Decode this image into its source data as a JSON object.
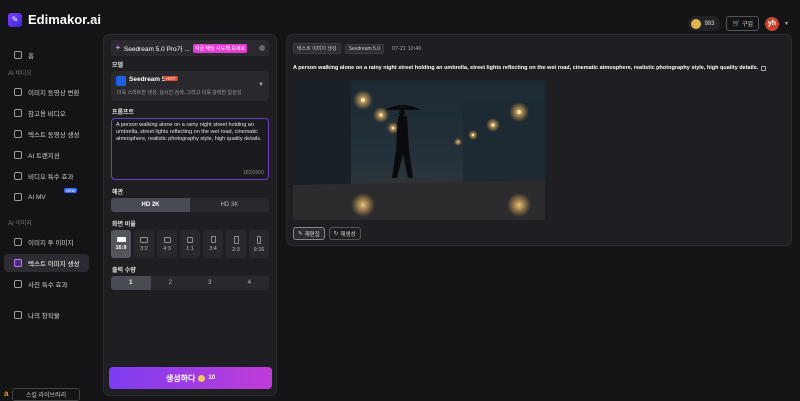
{
  "app": {
    "name": "Edimakor.ai"
  },
  "topbar": {
    "coins": "983",
    "buy_label": "구입",
    "avatar": "yh"
  },
  "sidebar": {
    "home": "홈",
    "sections": [
      {
        "label": "AI 비디오",
        "items": [
          "이미지 동영상 변환",
          "참고용 비디오",
          "텍스트 동영상 생성",
          "AI 트랜지션",
          "비디오 특수 효과",
          "AI MV"
        ]
      },
      {
        "label": "AI 이미지",
        "items": [
          "이미지 투 이미지",
          "텍스트 이미지 생성",
          "사진 특수 효과"
        ]
      }
    ],
    "my_works": "나의 창작물",
    "new_badge": "NEW",
    "library": "스킬 라이브러리",
    "active_item": "텍스트 이미지 생성"
  },
  "panel": {
    "promo_text": "Seedream 5.0 Pro가 ...",
    "promo_badge": "지금 해당 사도해 보세요",
    "model_label": "모델",
    "model_name": "Seedream 5.0",
    "model_tag": "HOT",
    "model_desc": "더욱 스마트한 생성, 실시간 검색, 그리고 더욱 강력한 일관성",
    "prompt_label": "프롬프트",
    "prompt_text": "A person walking alone on a rainy night street holding an umbrella, street lights reflecting on the wet road, cinematic atmosphere, realistic photography style, high quality details.",
    "prompt_count": "182/2000",
    "quality_label": "해관",
    "quality_options": [
      "HD 2K",
      "HD 3K"
    ],
    "quality_selected": 0,
    "ratio_label": "화면 비율",
    "ratios": [
      "16:9",
      "3:2",
      "4:3",
      "1:1",
      "3:4",
      "2:3",
      "9:16"
    ],
    "ratio_selected": 0,
    "count_label": "출력 수량",
    "counts": [
      "1",
      "2",
      "3",
      "4"
    ],
    "count_selected": 0,
    "generate_label": "생성하다",
    "generate_cost": "10"
  },
  "result": {
    "tags": [
      "텍스트 이미지 생성",
      "Seedream 5.0"
    ],
    "timestamp": "07-21 10:40",
    "prompt": "A person walking alone on a rainy night street holding an umbrella, street lights reflecting on the wet road, cinematic atmosphere, realistic photography style, high quality details.",
    "edit_label": "재편집",
    "regen_label": "재생성"
  },
  "colors": {
    "accent": "#7d3cf0",
    "accent2": "#c13cd8",
    "bg": "#141416",
    "panel": "#1f1f23"
  }
}
